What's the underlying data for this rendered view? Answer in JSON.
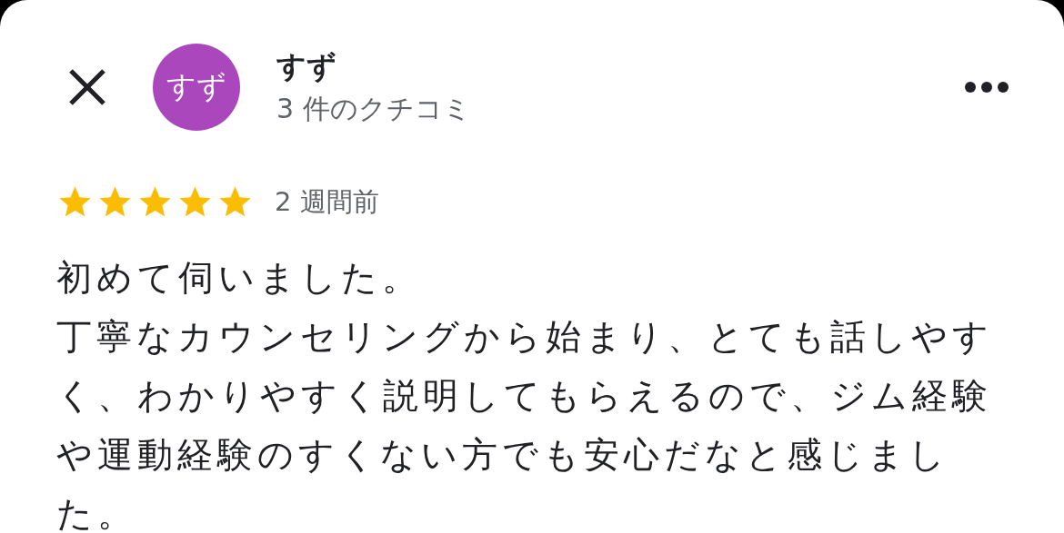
{
  "reviewer": {
    "avatar_text": "すず",
    "name": "すず",
    "review_count": "3 件のクチコミ"
  },
  "review": {
    "stars": 5,
    "time": "2 週間前",
    "paragraphs": [
      "初めて伺いました。",
      "丁寧なカウンセリングから始まり、とても話しやすく、わかりやすく説明してもらえるので、ジム経験や運動経験のすくない方でも安心だなと感じました。"
    ]
  }
}
